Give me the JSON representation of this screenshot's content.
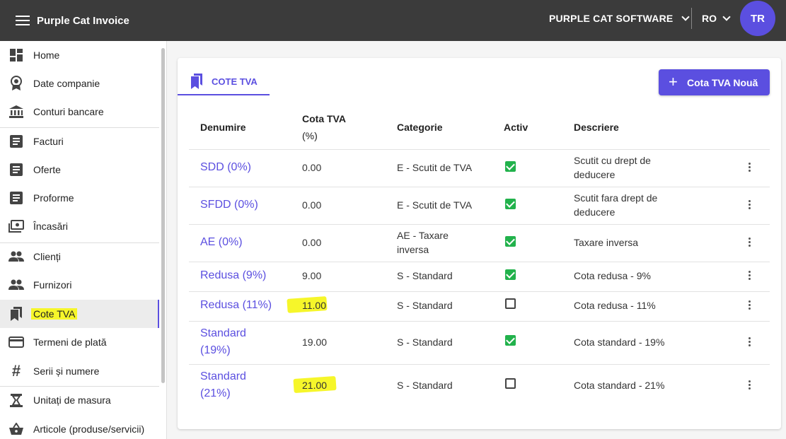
{
  "app_title": "Purple Cat Invoice",
  "company_name": "PURPLE CAT SOFTWARE",
  "language": "RO",
  "user_initials": "TR",
  "colors": {
    "accent": "#5b4fe0",
    "topbar": "#3b3b3b",
    "active_check": "#22b24c",
    "highlight": "#f6f62a"
  },
  "sidebar": {
    "items": [
      {
        "label": "Home",
        "icon": "dashboard-icon"
      },
      {
        "label": "Date companie",
        "icon": "award-icon"
      },
      {
        "label": "Conturi bancare",
        "icon": "bank-icon"
      },
      {
        "label": "Facturi",
        "icon": "document-icon"
      },
      {
        "label": "Oferte",
        "icon": "document-icon"
      },
      {
        "label": "Proforme",
        "icon": "document-icon"
      },
      {
        "label": "Încasări",
        "icon": "cash-icon"
      },
      {
        "label": "Clienți",
        "icon": "people-icon"
      },
      {
        "label": "Furnizori",
        "icon": "people-icon"
      },
      {
        "label": "Cote TVA",
        "icon": "bookmarks-icon"
      },
      {
        "label": "Termeni de plată",
        "icon": "credit-card-icon"
      },
      {
        "label": "Serii și numere",
        "icon": "hash-icon"
      },
      {
        "label": "Unitați de masura",
        "icon": "scale-icon"
      },
      {
        "label": "Articole (produse/servicii)",
        "icon": "basket-icon"
      }
    ]
  },
  "page": {
    "tab_label": "COTE TVA",
    "add_button_label": "Cota TVA Nouă"
  },
  "table": {
    "headers": {
      "name": "Denumire",
      "rate_line1": "Cota TVA",
      "rate_line2": "(%)",
      "category": "Categorie",
      "active": "Activ",
      "description": "Descriere"
    },
    "rows": [
      {
        "name": "SDD (0%)",
        "rate": "0.00",
        "category": "E - Scutit de TVA",
        "active": true,
        "description": "Scutit cu drept de deducere"
      },
      {
        "name": "SFDD (0%)",
        "rate": "0.00",
        "category": "E - Scutit de TVA",
        "active": true,
        "description": "Scutit fara drept de deducere"
      },
      {
        "name": "AE (0%)",
        "rate": "0.00",
        "category": "AE - Taxare inversa",
        "active": true,
        "description": "Taxare inversa"
      },
      {
        "name": "Redusa (9%)",
        "rate": "9.00",
        "category": "S - Standard",
        "active": true,
        "description": "Cota redusa - 9%"
      },
      {
        "name": "Redusa (11%)",
        "rate": "11.00",
        "category": "S - Standard",
        "active": false,
        "description": "Cota redusa - 11%"
      },
      {
        "name": "Standard (19%)",
        "rate": "19.00",
        "category": "S - Standard",
        "active": true,
        "description": "Cota standard - 19%"
      },
      {
        "name": "Standard (21%)",
        "rate": "21.00",
        "category": "S - Standard",
        "active": false,
        "description": "Cota standard - 21%"
      }
    ]
  }
}
